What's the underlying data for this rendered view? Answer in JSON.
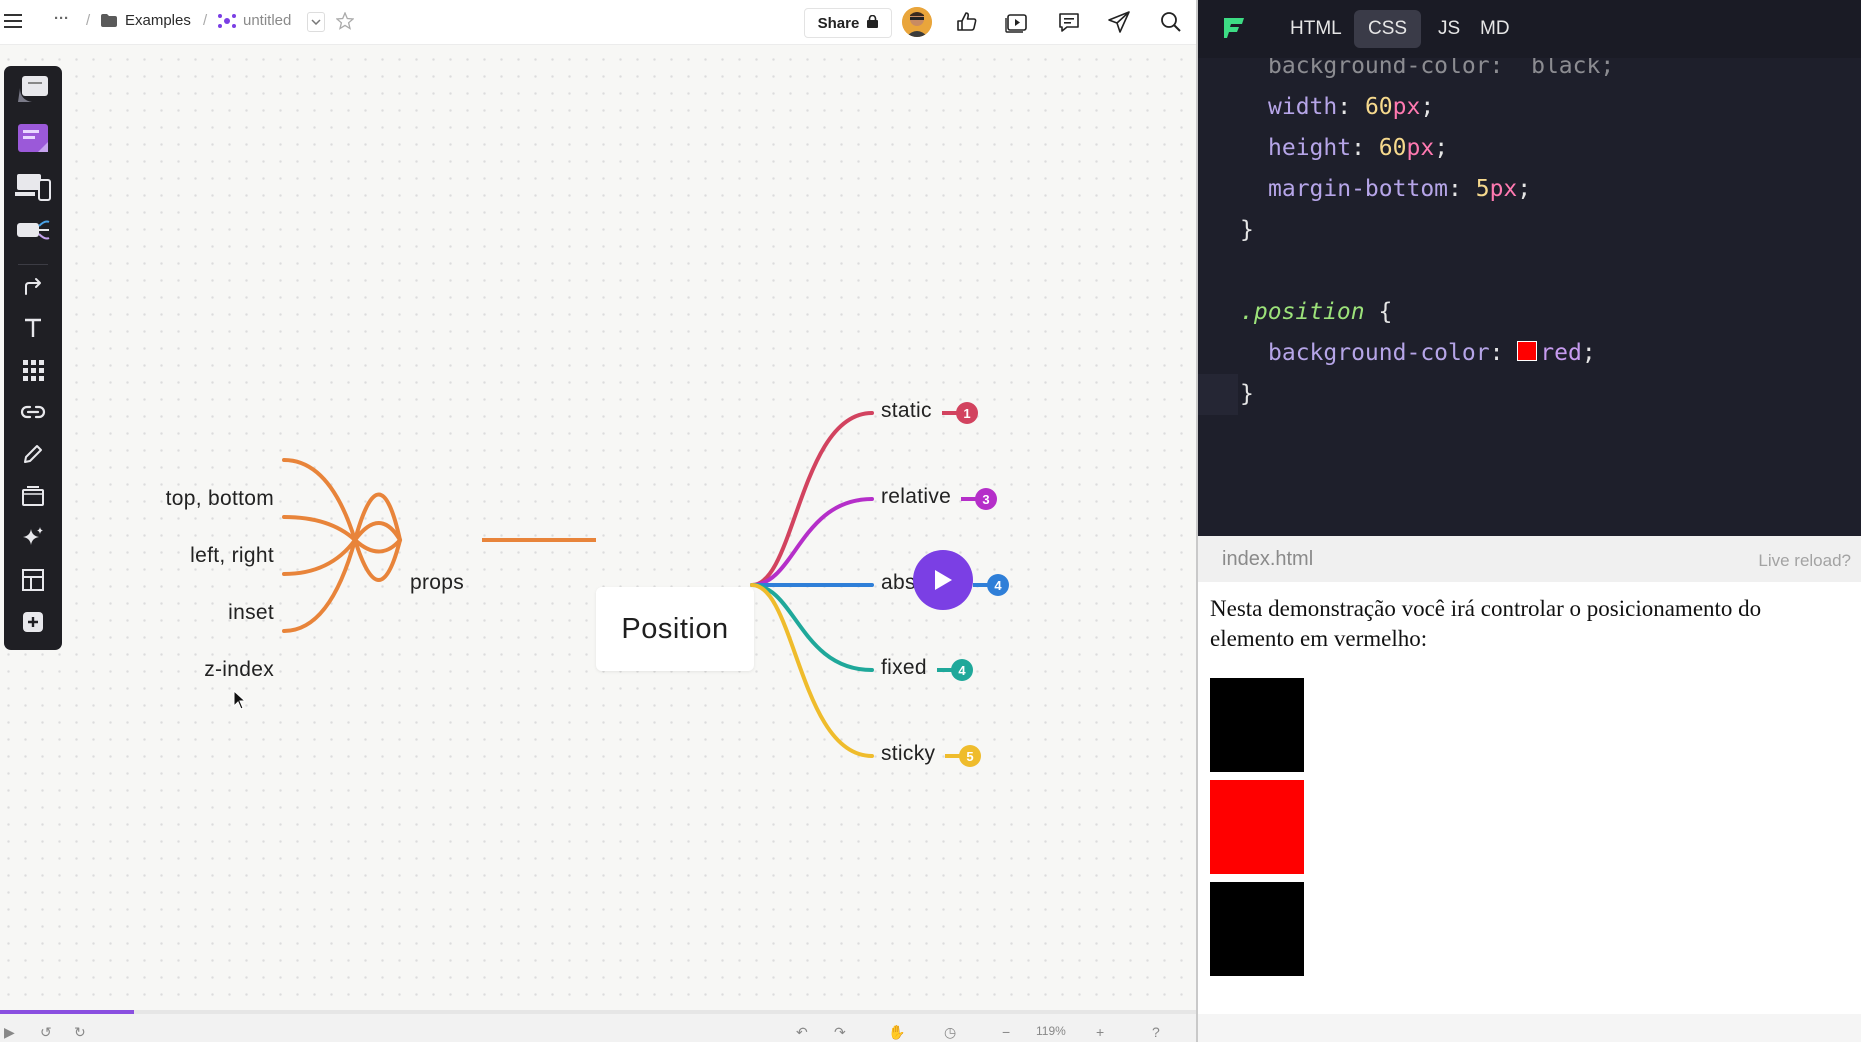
{
  "topbar": {
    "breadcrumb_more": "···",
    "breadcrumb_sep1": "/",
    "folder_label": "Examples",
    "breadcrumb_sep2": "/",
    "doc_title": "untitled",
    "share_label": "Share"
  },
  "toolbar": {
    "tools": [
      "sticky-notes-icon",
      "sticky-note-icon",
      "devices-icon",
      "toggle-icon",
      "arrow-icon",
      "text-icon",
      "grid-icon",
      "link-icon",
      "pen-icon",
      "frame-icon",
      "sparkle-icon",
      "layout-icon",
      "add-icon"
    ]
  },
  "mindmap": {
    "center": "Position",
    "props_node": "props",
    "props_children": [
      "top, bottom",
      "left, right",
      "inset",
      "z-index"
    ],
    "branches": [
      {
        "label": "static",
        "badge": "1",
        "color": "#d2435f"
      },
      {
        "label": "relative",
        "badge": "3",
        "color": "#b52fc9"
      },
      {
        "label": "absolute",
        "badge": "4",
        "color": "#2f7fd8"
      },
      {
        "label": "fixed",
        "badge": "4",
        "color": "#1fa89a"
      },
      {
        "label": "sticky",
        "badge": "5",
        "color": "#efbc2c"
      }
    ],
    "props_color": "#e8843a"
  },
  "playback": {
    "progress_fraction": 0.112,
    "zoom_label": "119%"
  },
  "editor": {
    "tabs": [
      "HTML",
      "CSS",
      "JS",
      "MD"
    ],
    "active_tab": "CSS",
    "lines": {
      "l0": "background-color:  black;",
      "l1_prop": "width",
      "l1_num": "60",
      "l1_unit": "px",
      "l2_prop": "height",
      "l2_num": "60",
      "l2_unit": "px",
      "l3_prop": "margin-bottom",
      "l3_num": "5",
      "l3_unit": "px",
      "l4": "}",
      "l6_sel": ".position",
      "l6_brace": "{",
      "l7_prop": "background-color",
      "l7_val": "red",
      "l8": "}"
    }
  },
  "preview": {
    "filename": "index.html",
    "live_reload": "Live reload?",
    "text": "Nesta demonstração você irá controlar o posicionamento do elemento em vermelho:",
    "boxes": [
      "#000000",
      "#ff0000",
      "#000000"
    ]
  }
}
